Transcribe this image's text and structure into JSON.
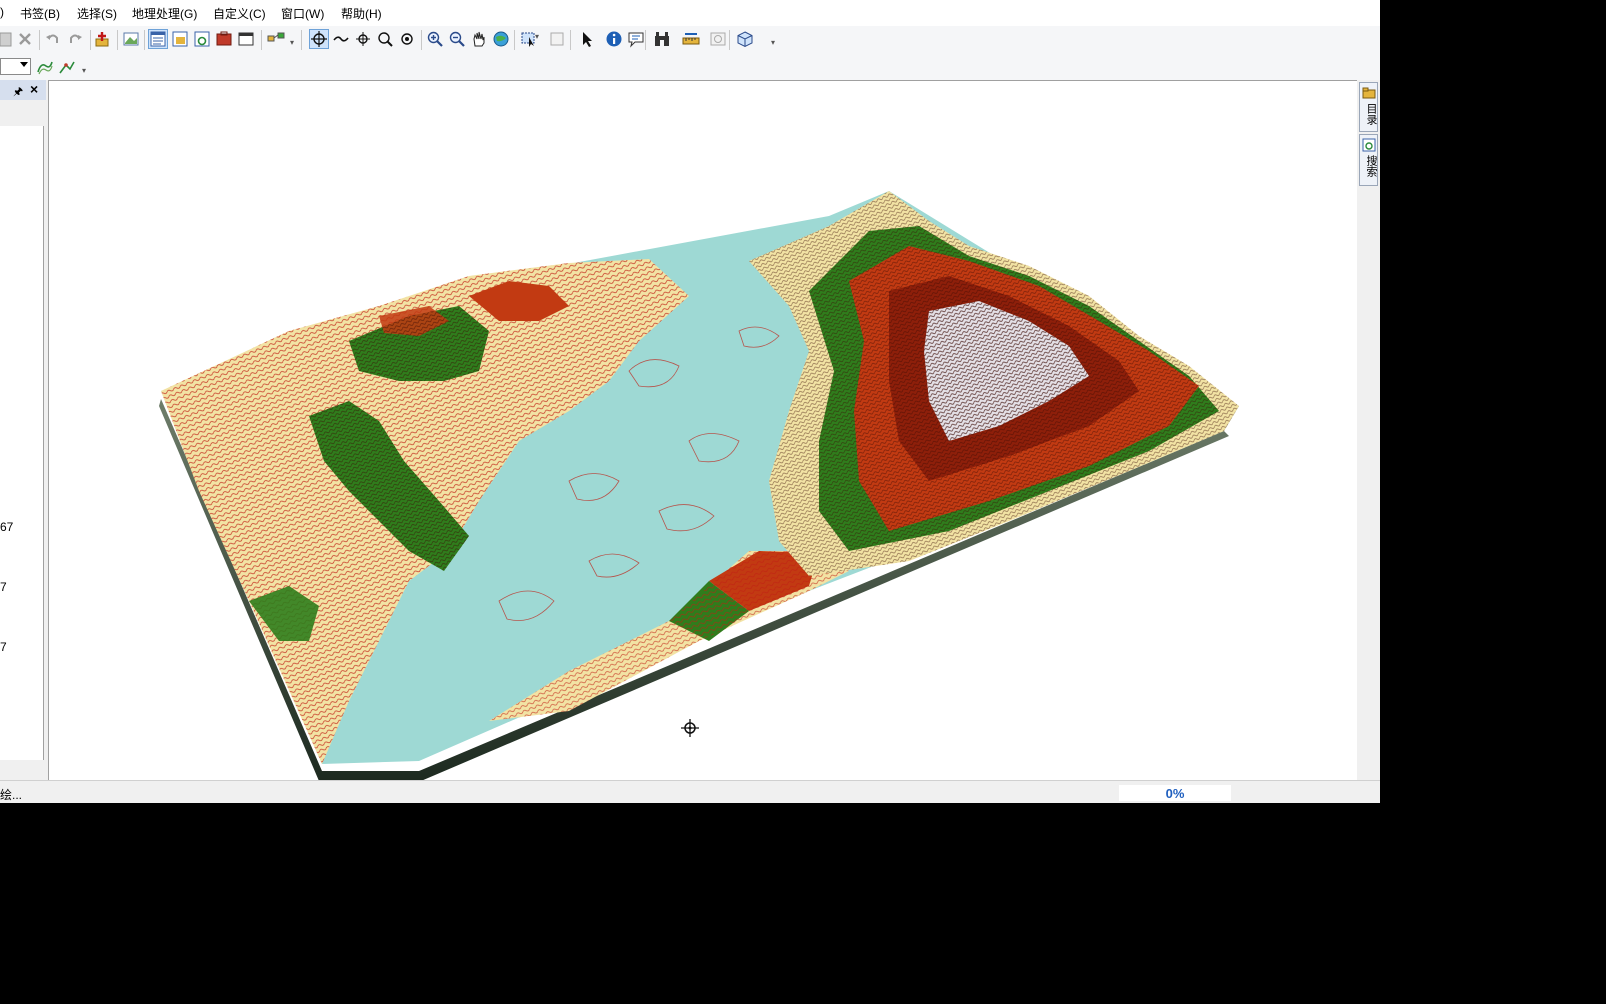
{
  "menu": {
    "items": [
      {
        "label": ")"
      },
      {
        "label": "书签(B)"
      },
      {
        "label": "选择(S)"
      },
      {
        "label": "地理处理(G)"
      },
      {
        "label": "自定义(C)"
      },
      {
        "label": "窗口(W)"
      },
      {
        "label": "帮助(H)"
      }
    ]
  },
  "toolbar": {
    "icons": [
      "paste-icon",
      "delete-icon",
      "undo-icon",
      "redo-icon",
      "add-data-icon",
      "add-basemap-icon",
      "table-of-contents-icon",
      "catalog-window-icon",
      "search-window-icon",
      "arctoolbox-icon",
      "python-window-icon",
      "model-builder-icon",
      "navigate-icon",
      "fly-icon",
      "center-target-icon",
      "zoom-to-target-icon",
      "set-observer-icon",
      "zoom-in-icon",
      "zoom-out-icon",
      "pan-icon",
      "full-extent-icon",
      "select-features-icon",
      "clear-selection-icon",
      "select-elements-icon",
      "identify-icon",
      "html-popup-icon",
      "find-icon",
      "measure-icon",
      "time-slider-icon",
      "3d-effects-icon"
    ]
  },
  "left_panel": {
    "legend_values": [
      "67",
      "7",
      "7"
    ]
  },
  "right_dock": {
    "tabs": [
      {
        "label": "目录"
      },
      {
        "label": "搜索"
      }
    ]
  },
  "status": {
    "text": "绘...",
    "progress": "0%"
  },
  "colors": {
    "water": "#9ed9d4",
    "sand": "#f2e3a4",
    "green": "#2f7d1c",
    "red": "#c23a12",
    "dark_red": "#8e1f0a",
    "snow": "#e4e0e6"
  }
}
